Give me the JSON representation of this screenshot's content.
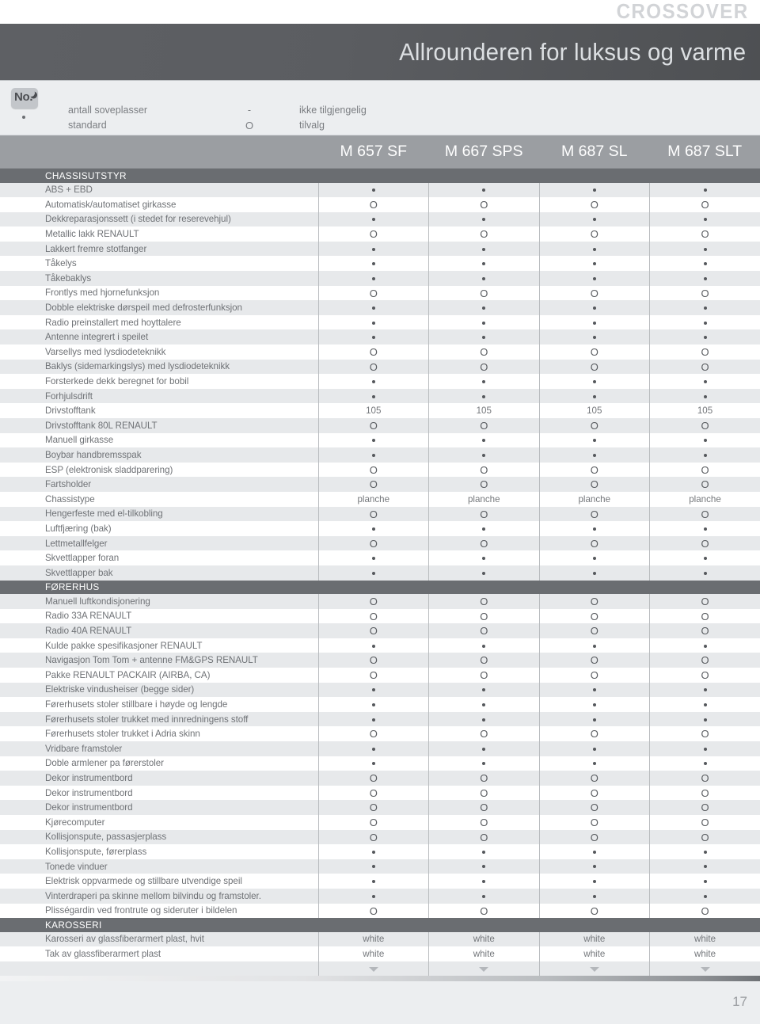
{
  "brand": {
    "wordmark": "CROSSOVER"
  },
  "header": {
    "title": "Allrounderen for luksus og varme"
  },
  "legend": {
    "badge_text": "No.",
    "badge_icon": "moon-icon",
    "rows": [
      {
        "icon": "sleeping-places-icon",
        "label": "antall soveplasser",
        "symbol": "-",
        "meaning": "ikke tilgjengelig"
      },
      {
        "icon": "dot-icon",
        "label": "standard",
        "symbol": "O",
        "meaning": "tilvalg"
      }
    ]
  },
  "models": [
    "M 657 SF",
    "M 667 SPS",
    "M 687 SL",
    "M 687 SLT"
  ],
  "table": {
    "sections": [
      {
        "title": "CHASSISUTSTYR",
        "rows": [
          {
            "label": "ABS + EBD",
            "values": [
              "dot",
              "dot",
              "dot",
              "dot"
            ]
          },
          {
            "label": "Automatisk/automatiset girkasse",
            "values": [
              "o",
              "o",
              "o",
              "o"
            ]
          },
          {
            "label": "Dekkreparasjonssett (i stedet for reserevehjul)",
            "values": [
              "dot",
              "dot",
              "dot",
              "dot"
            ]
          },
          {
            "label": "Metallic lakk RENAULT",
            "values": [
              "o",
              "o",
              "o",
              "o"
            ]
          },
          {
            "label": "Lakkert fremre stotfanger",
            "values": [
              "dot",
              "dot",
              "dot",
              "dot"
            ]
          },
          {
            "label": "Tåkelys",
            "values": [
              "dot",
              "dot",
              "dot",
              "dot"
            ]
          },
          {
            "label": "Tåkebaklys",
            "values": [
              "dot",
              "dot",
              "dot",
              "dot"
            ]
          },
          {
            "label": "Frontlys med hjornefunksjon",
            "values": [
              "o",
              "o",
              "o",
              "o"
            ]
          },
          {
            "label": "Dobble elektriske dørspeil med defrosterfunksjon",
            "values": [
              "dot",
              "dot",
              "dot",
              "dot"
            ]
          },
          {
            "label": "Radio preinstallert med hoyttalere",
            "values": [
              "dot",
              "dot",
              "dot",
              "dot"
            ]
          },
          {
            "label": "Antenne integrert i speilet",
            "values": [
              "dot",
              "dot",
              "dot",
              "dot"
            ]
          },
          {
            "label": "Varsellys med lysdiodeteknikk",
            "values": [
              "o",
              "o",
              "o",
              "o"
            ]
          },
          {
            "label": "Baklys (sidemarkingslys) med lysdiodeteknikk",
            "values": [
              "o",
              "o",
              "o",
              "o"
            ]
          },
          {
            "label": "Forsterkede dekk beregnet for bobil",
            "values": [
              "dot",
              "dot",
              "dot",
              "dot"
            ]
          },
          {
            "label": "Forhjulsdrift",
            "values": [
              "dot",
              "dot",
              "dot",
              "dot"
            ]
          },
          {
            "label": "Drivstofftank",
            "values": [
              "105",
              "105",
              "105",
              "105"
            ]
          },
          {
            "label": "Drivstofftank 80L RENAULT",
            "values": [
              "o",
              "o",
              "o",
              "o"
            ]
          },
          {
            "label": "Manuell girkasse",
            "values": [
              "dot",
              "dot",
              "dot",
              "dot"
            ]
          },
          {
            "label": "Boybar handbremsspak",
            "values": [
              "dot",
              "dot",
              "dot",
              "dot"
            ]
          },
          {
            "label": "ESP (elektronisk sladdparering)",
            "values": [
              "o",
              "o",
              "o",
              "o"
            ]
          },
          {
            "label": "Fartsholder",
            "values": [
              "o",
              "o",
              "o",
              "o"
            ]
          },
          {
            "label": "Chassistype",
            "values": [
              "planche",
              "planche",
              "planche",
              "planche"
            ]
          },
          {
            "label": "Hengerfeste med el-tilkobling",
            "values": [
              "o",
              "o",
              "o",
              "o"
            ]
          },
          {
            "label": "Luftfjæring (bak)",
            "values": [
              "dot",
              "dot",
              "dot",
              "dot"
            ]
          },
          {
            "label": "Lettmetallfelger",
            "values": [
              "o",
              "o",
              "o",
              "o"
            ]
          },
          {
            "label": "Skvettlapper foran",
            "values": [
              "dot",
              "dot",
              "dot",
              "dot"
            ]
          },
          {
            "label": "Skvettlapper bak",
            "values": [
              "dot",
              "dot",
              "dot",
              "dot"
            ]
          }
        ]
      },
      {
        "title": "FØRERHUS",
        "rows": [
          {
            "label": "Manuell luftkondisjonering",
            "values": [
              "o",
              "o",
              "o",
              "o"
            ]
          },
          {
            "label": "Radio 33A RENAULT",
            "values": [
              "o",
              "o",
              "o",
              "o"
            ]
          },
          {
            "label": "Radio 40A RENAULT",
            "values": [
              "o",
              "o",
              "o",
              "o"
            ]
          },
          {
            "label": "Kulde pakke spesifikasjoner RENAULT",
            "values": [
              "dot",
              "dot",
              "dot",
              "dot"
            ]
          },
          {
            "label": "Navigasjon Tom Tom + antenne FM&GPS RENAULT",
            "values": [
              "o",
              "o",
              "o",
              "o"
            ]
          },
          {
            "label": "Pakke RENAULT PACKAIR (AIRBA, CA)",
            "values": [
              "o",
              "o",
              "o",
              "o"
            ]
          },
          {
            "label": "Elektriske vindusheiser (begge sider)",
            "values": [
              "dot",
              "dot",
              "dot",
              "dot"
            ]
          },
          {
            "label": "Førerhusets stoler stillbare i høyde og lengde",
            "values": [
              "dot",
              "dot",
              "dot",
              "dot"
            ]
          },
          {
            "label": "Førerhusets stoler trukket med innredningens stoff",
            "values": [
              "dot",
              "dot",
              "dot",
              "dot"
            ]
          },
          {
            "label": "Førerhusets stoler trukket i Adria skinn",
            "values": [
              "o",
              "o",
              "o",
              "o"
            ]
          },
          {
            "label": "Vridbare framstoler",
            "values": [
              "dot",
              "dot",
              "dot",
              "dot"
            ]
          },
          {
            "label": "Doble armlener pa førerstoler",
            "values": [
              "dot",
              "dot",
              "dot",
              "dot"
            ]
          },
          {
            "label": "Dekor instrumentbord",
            "values": [
              "o",
              "o",
              "o",
              "o"
            ]
          },
          {
            "label": "Dekor instrumentbord",
            "values": [
              "o",
              "o",
              "o",
              "o"
            ]
          },
          {
            "label": "Dekor instrumentbord",
            "values": [
              "o",
              "o",
              "o",
              "o"
            ]
          },
          {
            "label": "Kjørecomputer",
            "values": [
              "o",
              "o",
              "o",
              "o"
            ]
          },
          {
            "label": "Kollisjonspute, passasjerplass",
            "values": [
              "o",
              "o",
              "o",
              "o"
            ]
          },
          {
            "label": "Kollisjonspute, førerplass",
            "values": [
              "dot",
              "dot",
              "dot",
              "dot"
            ]
          },
          {
            "label": "Tonede vinduer",
            "values": [
              "dot",
              "dot",
              "dot",
              "dot"
            ]
          },
          {
            "label": "Elektrisk oppvarmede og stillbare utvendige speil",
            "values": [
              "dot",
              "dot",
              "dot",
              "dot"
            ]
          },
          {
            "label": "Vinterdraperi pa skinne mellom bilvindu og framstoler.",
            "values": [
              "dot",
              "dot",
              "dot",
              "dot"
            ]
          },
          {
            "label": "Plisségardin ved frontrute og sideruter i bildelen",
            "values": [
              "o",
              "o",
              "o",
              "o"
            ]
          }
        ]
      },
      {
        "title": "KAROSSERI",
        "rows": [
          {
            "label": "Karosseri av glassfiberarmert plast, hvit",
            "values": [
              "white",
              "white",
              "white",
              "white"
            ]
          },
          {
            "label": "Tak av glassfiberarmert plast",
            "values": [
              "white",
              "white",
              "white",
              "white"
            ]
          },
          {
            "label": "",
            "values": [
              "arrow",
              "arrow",
              "arrow",
              "arrow"
            ]
          }
        ]
      }
    ]
  },
  "footer": {
    "page_number": "17"
  }
}
